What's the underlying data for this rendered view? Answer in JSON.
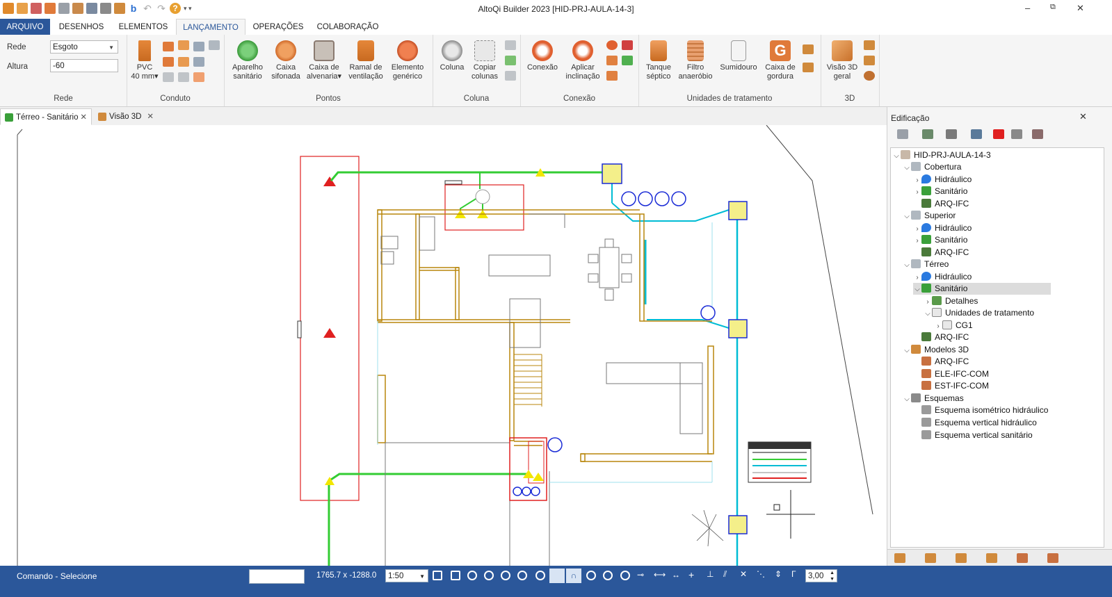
{
  "window": {
    "title": "AltoQi Builder 2023 [HID-PRJ-AULA-14-3]",
    "controls": {
      "minimize": "–",
      "restore": "⧉",
      "close": "✕"
    }
  },
  "menu_tabs": [
    "ARQUIVO",
    "DESENHOS",
    "ELEMENTOS",
    "LANÇAMENTO",
    "OPERAÇÕES",
    "COLABORAÇÃO"
  ],
  "ribbon": {
    "rede": {
      "group_label": "Rede",
      "rede_label": "Rede",
      "rede_value": "Esgoto",
      "altura_label": "Altura",
      "altura_value": "-60"
    },
    "conduto": {
      "group_label": "Conduto",
      "pvc_label": "PVC",
      "pvc_size": "40 mm▾"
    },
    "pontos": {
      "group_label": "Pontos",
      "b1_l1": "Aparelho",
      "b1_l2": "sanitário",
      "b2_l1": "Caixa",
      "b2_l2": "sifonada",
      "b3_l1": "Caixa de",
      "b3_l2": "alvenaria▾",
      "b4_l1": "Ramal de",
      "b4_l2": "ventilação",
      "b5_l1": "Elemento",
      "b5_l2": "genérico"
    },
    "coluna": {
      "group_label": "Coluna",
      "b1_l1": "Coluna",
      "b2_l1": "Copiar",
      "b2_l2": "colunas"
    },
    "conexao": {
      "group_label": "Conexão",
      "b1_l1": "Conexão",
      "b2_l1": "Aplicar",
      "b2_l2": "inclinação"
    },
    "unidades": {
      "group_label": "Unidades de tratamento",
      "b1_l1": "Tanque",
      "b1_l2": "séptico",
      "b2_l1": "Filtro",
      "b2_l2": "anaeróbio",
      "b3_l1": "Sumidouro",
      "b4_l1": "Caixa de",
      "b4_l2": "gordura"
    },
    "v3d": {
      "group_label": "3D",
      "b1_l1": "Visão 3D",
      "b1_l2": "geral"
    }
  },
  "doc_tabs": [
    {
      "label": "Térreo - Sanitário"
    },
    {
      "label": "Visão 3D"
    }
  ],
  "panel": {
    "title": "Edificação",
    "close": "✕",
    "tree": [
      "HID-PRJ-AULA-14-3",
      "Cobertura",
      "Hidráulico",
      "Sanitário",
      "ARQ-IFC",
      "Superior",
      "Hidráulico",
      "Sanitário",
      "ARQ-IFC",
      "Térreo",
      "Hidráulico",
      "Sanitário",
      "Detalhes",
      "Unidades de tratamento",
      "CG1",
      "ARQ-IFC",
      "Modelos 3D",
      "ARQ-IFC",
      "ELE-IFC-COM",
      "EST-IFC-COM",
      "Esquemas",
      "Esquema isométrico hidráulico",
      "Esquema vertical hidráulico",
      "Esquema vertical sanitário"
    ]
  },
  "status": {
    "command": "Comando - Selecione",
    "coords": "1765.7 x -1288.0",
    "scale": "1:50",
    "value": "3,00"
  },
  "colors": {
    "accent": "#2b579a",
    "wall": "#b8860b",
    "pipe_green": "#33cc33",
    "pipe_cyan": "#00bcd4",
    "highlight_red": "#e02020",
    "fixture_yellow": "#f2e600",
    "blue_symbol": "#1a2bd6"
  }
}
